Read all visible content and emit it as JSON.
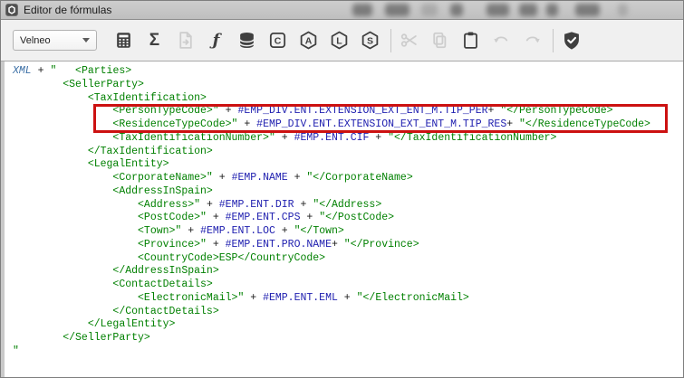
{
  "window": {
    "title": "Editor de fórmulas"
  },
  "toolbar": {
    "combo": {
      "value": "Velneo"
    },
    "buttons": [
      {
        "name": "calculator-button",
        "enabled": true
      },
      {
        "name": "sum-button",
        "glyph": "Σ",
        "enabled": true
      },
      {
        "name": "file-export-button",
        "enabled": false
      },
      {
        "name": "function-button",
        "glyph": "ƒ",
        "enabled": true
      },
      {
        "name": "database-fields-button",
        "enabled": true
      },
      {
        "name": "constants-button",
        "glyph": "C",
        "enabled": true
      },
      {
        "name": "hexagon-a-button",
        "glyph": "A",
        "enabled": true
      },
      {
        "name": "hexagon-l-button",
        "glyph": "L",
        "enabled": true
      },
      {
        "name": "hexagon-s-button",
        "glyph": "S",
        "enabled": true
      },
      {
        "name": "cut-button",
        "enabled": false
      },
      {
        "name": "copy-button",
        "enabled": false
      },
      {
        "name": "paste-button",
        "enabled": true
      },
      {
        "name": "undo-button",
        "enabled": false
      },
      {
        "name": "redo-button",
        "enabled": false
      },
      {
        "name": "validate-shield-button",
        "enabled": true
      }
    ]
  },
  "colors": {
    "tag_green": "#008000",
    "identifier_blue": "#2121b0",
    "variable_blue": "#3a6ea5",
    "operator_black": "#1a1a1a",
    "highlight_red": "#cc1111"
  },
  "editor": {
    "highlighted_lines": [
      4,
      5
    ],
    "lines": [
      [
        [
          "var",
          "XML"
        ],
        [
          "op",
          " + "
        ],
        [
          "str",
          "\"   <Parties>"
        ]
      ],
      [
        [
          "str",
          "        <SellerParty>"
        ]
      ],
      [
        [
          "str",
          "            <TaxIdentification>"
        ]
      ],
      [
        [
          "str",
          "                <PersonTypeCode>\""
        ],
        [
          "op",
          " + "
        ],
        [
          "id",
          "#EMP_DIV.ENT.EXTENSION_EXT_ENT_M.TIP_PER"
        ],
        [
          "op",
          "+ "
        ],
        [
          "str",
          "\"</PersonTypeCode>"
        ]
      ],
      [
        [
          "str",
          "                <ResidenceTypeCode>\""
        ],
        [
          "op",
          " + "
        ],
        [
          "id",
          "#EMP_DIV.ENT.EXTENSION_EXT_ENT_M.TIP_RES"
        ],
        [
          "op",
          "+ "
        ],
        [
          "str",
          "\"</ResidenceTypeCode>"
        ]
      ],
      [
        [
          "str",
          "                <TaxIdentificationNumber>\""
        ],
        [
          "op",
          " + "
        ],
        [
          "id",
          "#EMP.ENT.CIF"
        ],
        [
          "op",
          " + "
        ],
        [
          "str",
          "\"</TaxIdentificationNumber>"
        ]
      ],
      [
        [
          "str",
          "            </TaxIdentification>"
        ]
      ],
      [
        [
          "str",
          "            <LegalEntity>"
        ]
      ],
      [
        [
          "str",
          "                <CorporateName>\""
        ],
        [
          "op",
          " + "
        ],
        [
          "id",
          "#EMP.NAME"
        ],
        [
          "op",
          " + "
        ],
        [
          "str",
          "\"</CorporateName>"
        ]
      ],
      [
        [
          "str",
          "                <AddressInSpain>"
        ]
      ],
      [
        [
          "str",
          "                    <Address>\""
        ],
        [
          "op",
          " + "
        ],
        [
          "id",
          "#EMP.ENT.DIR"
        ],
        [
          "op",
          " + "
        ],
        [
          "str",
          "\"</Address>"
        ]
      ],
      [
        [
          "str",
          "                    <PostCode>\""
        ],
        [
          "op",
          " + "
        ],
        [
          "id",
          "#EMP.ENT.CPS"
        ],
        [
          "op",
          " + "
        ],
        [
          "str",
          "\"</PostCode>"
        ]
      ],
      [
        [
          "str",
          "                    <Town>\""
        ],
        [
          "op",
          " + "
        ],
        [
          "id",
          "#EMP.ENT.LOC"
        ],
        [
          "op",
          " + "
        ],
        [
          "str",
          "\"</Town>"
        ]
      ],
      [
        [
          "str",
          "                    <Province>\""
        ],
        [
          "op",
          " + "
        ],
        [
          "id",
          "#EMP.ENT.PRO.NAME"
        ],
        [
          "op",
          "+ "
        ],
        [
          "str",
          "\"</Province>"
        ]
      ],
      [
        [
          "str",
          "                    <CountryCode>ESP</CountryCode>"
        ]
      ],
      [
        [
          "str",
          "                </AddressInSpain>"
        ]
      ],
      [
        [
          "str",
          "                <ContactDetails>"
        ]
      ],
      [
        [
          "str",
          "                    <ElectronicMail>\""
        ],
        [
          "op",
          " + "
        ],
        [
          "id",
          "#EMP.ENT.EML"
        ],
        [
          "op",
          " + "
        ],
        [
          "str",
          "\"</ElectronicMail>"
        ]
      ],
      [
        [
          "str",
          "                </ContactDetails>"
        ]
      ],
      [
        [
          "str",
          "            </LegalEntity>"
        ]
      ],
      [
        [
          "str",
          "        </SellerParty>"
        ]
      ],
      [
        [
          "str",
          "\""
        ]
      ]
    ]
  }
}
